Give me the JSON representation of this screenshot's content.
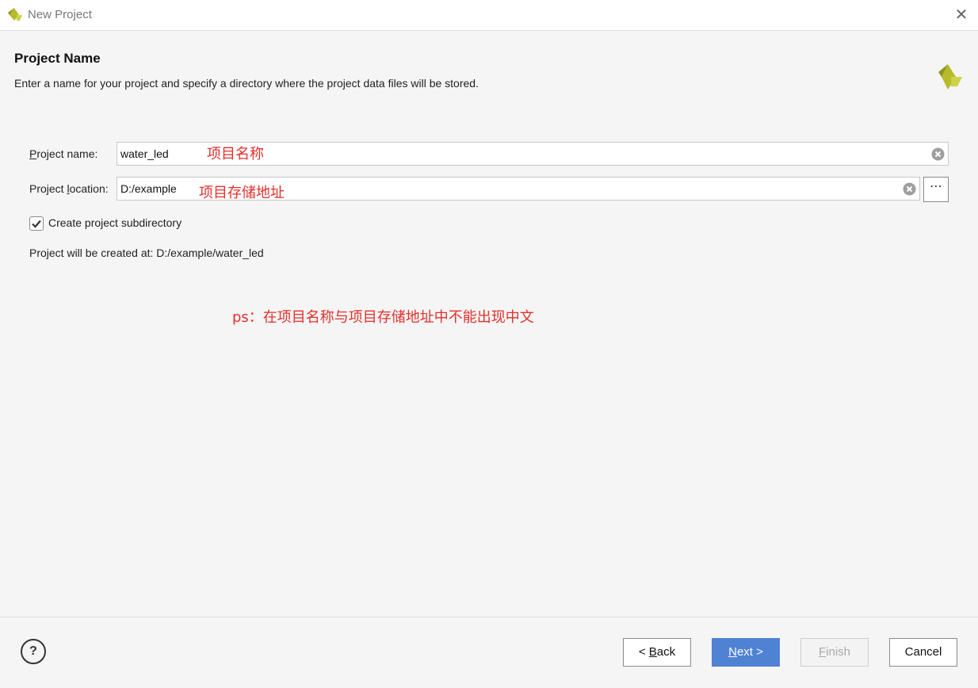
{
  "window": {
    "title": "New Project"
  },
  "header": {
    "heading": "Project Name",
    "description": "Enter a name for your project and specify a directory where the project data files will be stored."
  },
  "form": {
    "project_name": {
      "label_mn": "P",
      "label_rest": "roject name:",
      "value": "water_led"
    },
    "project_location": {
      "label_pre": "Project ",
      "label_mn": "l",
      "label_rest": "ocation:",
      "value": "D:/example",
      "browse_label": "⋯"
    },
    "subdirectory": {
      "label": "Create project subdirectory",
      "checked": true
    },
    "created_at_prefix": "Project will be created at: ",
    "created_at_path": "D:/example/water_led"
  },
  "annotations": {
    "name_note": "项目名称",
    "location_note": "项目存储地址",
    "ps_note": "ps：在项目名称与项目存储地址中不能出现中文"
  },
  "footer": {
    "help": "?",
    "back": {
      "prefix": "< ",
      "mn": "B",
      "rest": "ack"
    },
    "next": {
      "mn": "N",
      "rest": "ext >"
    },
    "finish": {
      "mn": "F",
      "rest": "inish"
    },
    "cancel": "Cancel"
  },
  "colors": {
    "accent": "#4f82d3",
    "annotation": "#e2302c",
    "logo": "#b6bc2a"
  },
  "icons": {
    "app": "vivado-logo-icon",
    "close": "close-icon",
    "clear": "clear-icon",
    "check": "checkmark-icon"
  }
}
